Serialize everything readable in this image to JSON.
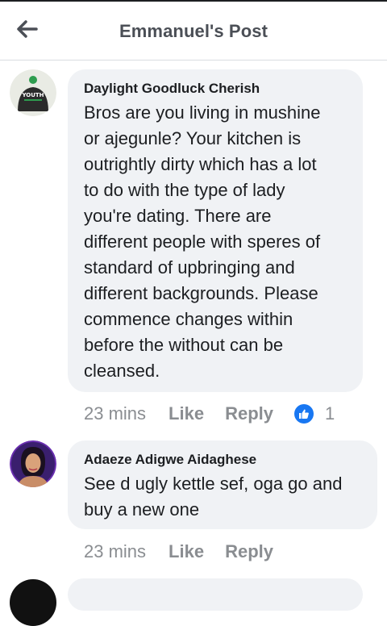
{
  "header": {
    "title": "Emmanuel's Post",
    "back_icon": "arrow-left-icon"
  },
  "comments": [
    {
      "author": "Daylight Goodluck Cherish",
      "text": "Bros are you living in mushine\nor ajegunle? Your kitchen is\noutrightly dirty which has a lot\nto do with the type of lady\nyou're dating. There are\ndifferent people with speres of\nstandard of upbringing and\ndifferent backgrounds. Please\ncommence changes within\nbefore the without can be\ncleansed.",
      "time": "23 mins",
      "like_label": "Like",
      "reply_label": "Reply",
      "reaction_count": "1",
      "avatar_text": "YOUTH"
    },
    {
      "author": "Adaeze Adigwe Aidaghese",
      "text": "See d ugly kettle sef, oga go and\nbuy a new one",
      "time": "23 mins",
      "like_label": "Like",
      "reply_label": "Reply"
    }
  ],
  "colors": {
    "accent": "#1877f2",
    "bubble": "#f0f2f5",
    "muted": "#8a8d91",
    "title": "#4b4f56"
  }
}
